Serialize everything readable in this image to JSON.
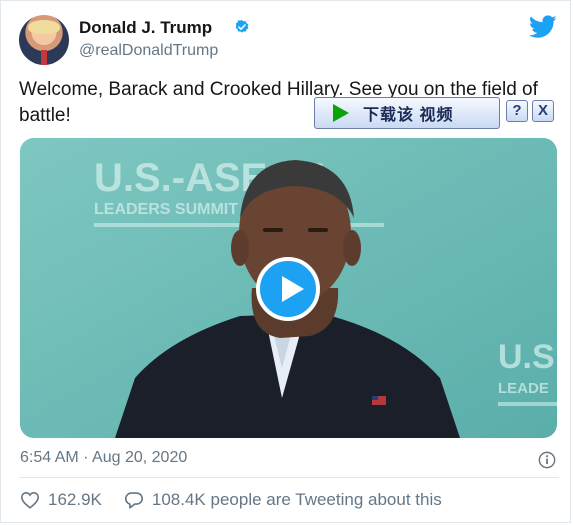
{
  "author": {
    "name": "Donald J. Trump",
    "handle": "@realDonaldTrump",
    "avatar_icon": "profile-photo",
    "verified_icon": "verified-badge-icon"
  },
  "brand_icon": "twitter-bird-icon",
  "tweet": {
    "text": "Welcome, Barack and Crooked Hillary. See you on the field of battle!"
  },
  "download_overlay": {
    "label": "下载该 视频",
    "help": "?",
    "close": "X"
  },
  "video": {
    "play_icon": "play-icon",
    "backdrop_text_1": "U.S.-ASEAN",
    "backdrop_text_2": "LEADERS SUMMIT",
    "backdrop_text_3": "U.S",
    "backdrop_text_4": "LEADE"
  },
  "meta": {
    "timestamp": "6:54 AM · Aug 20, 2020",
    "info_icon": "info-icon"
  },
  "stats": {
    "likes": "162.9K",
    "replies_text": "108.4K people are Tweeting about this"
  },
  "colors": {
    "brand_blue": "#1da1f2",
    "text_primary": "#14171a",
    "text_secondary": "#657786",
    "video_bg": "#6cbdb8"
  }
}
